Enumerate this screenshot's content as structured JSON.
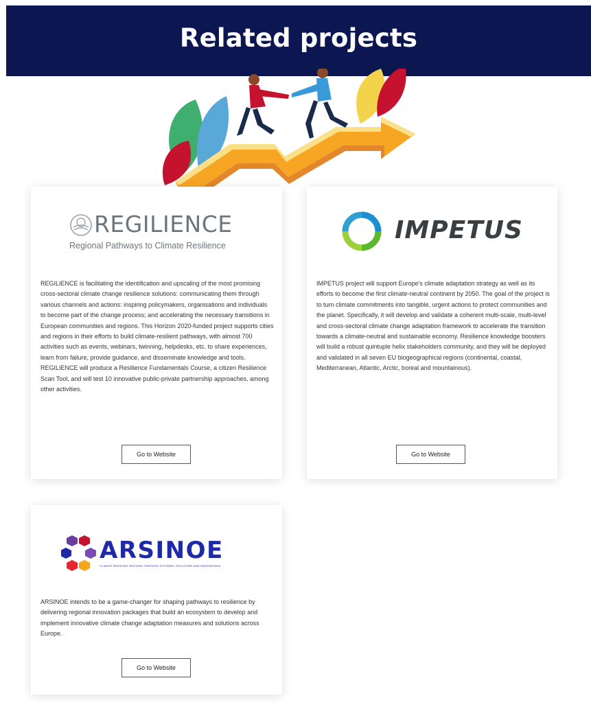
{
  "page": {
    "title": "Related projects"
  },
  "colors": {
    "banner_bg": "#0c1650",
    "card_bg": "#ffffff",
    "impetus_green": "#5cb82f",
    "impetus_blue": "#1b8fd1",
    "arsinoe_blue": "#1f2aa8"
  },
  "illustration": {
    "icon": "handshake-arrow-illustration"
  },
  "projects": [
    {
      "logo_name": "REGILIENCE",
      "logo_tagline": "Regional Pathways to Climate Resilience",
      "description": "REGILIENCE is facilitating the identification and upscaling of the most promising cross-sectoral climate change resilience solutions: communicating them through various channels and actions: inspiring policymakers, organisations and individuals to become part of the change process; and accelerating the necessary transitions in European communities and regions. This Horizon 2020-funded project supports cities and regions in their efforts to build climate-resilient pathways, with almost 700 activities such as events, webinars, twinning, helpdesks, etc. to share experiences, learn from failure, provide guidance, and disseminate knowledge and tools. REGILIENCE will produce a Resilience Fundamentals Course, a citizen Resilience Scan Tool, and will test 10 innovative public-private partnership approaches, among other activities.",
      "button_label": "Go to Website"
    },
    {
      "logo_name": "IMPETUS",
      "description": "IMPETUS project will support Europe's climate adaptation strategy as well as its efforts to become the first climate-neutral continent by 2050. The goal of the project is to turn climate commitments into tangible, urgent actions to protect communities and the planet. Specifically, it will develop and validate a coherent multi-scale, multi-level and cross-sectoral climate change adaptation framework to accelerate the transition towards a climate-neutral and sustainable economy. Resilience knowledge boosters will build a robust quintuple helix stakeholders community, and they will be deployed and validated in all seven EU biogeographical regions (continental, coastal, Mediterranean, Atlantic, Arctic, boreal and mountainous).",
      "button_label": "Go to Website"
    },
    {
      "logo_name": "ARSINOE",
      "logo_tagline": "CLIMATE RESILIENT REGIONS THROUGH SYSTEMIC SOLUTIONS AND INNOVATIONS",
      "description": "ARSINOE intends to be a game-changer for shaping pathways to resilience by delivering regional innovation packages that build an ecosystem to develop and implement innovative climate change adaptation measures and solutions across Europe.",
      "button_label": "Go to Website"
    }
  ]
}
